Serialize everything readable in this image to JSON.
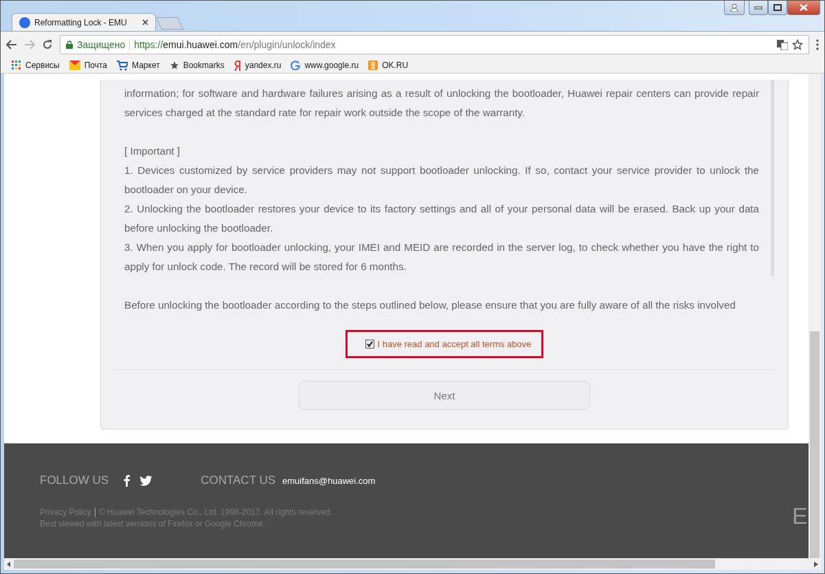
{
  "browser": {
    "tabs": [
      {
        "title": "Reformatting Lock - EMU",
        "selected": true
      }
    ],
    "address": {
      "secure_label": "Защищено",
      "scheme": "https://",
      "host": "emui.huawei.com",
      "path": "/en/plugin/unlock/index"
    },
    "bookmarks": [
      {
        "label": "Сервисы",
        "kind": "apps"
      },
      {
        "label": "Почта",
        "kind": "mail"
      },
      {
        "label": "Маркет",
        "kind": "cart"
      },
      {
        "label": "Bookmarks",
        "kind": "star"
      },
      {
        "label": "yandex.ru",
        "kind": "ya"
      },
      {
        "label": "www.google.ru",
        "kind": "g"
      },
      {
        "label": "OK.RU",
        "kind": "ok"
      }
    ]
  },
  "terms": {
    "paragraphs": [
      "information; for software and hardware failures arising as a result of unlocking the bootloader, Huawei repair centers can provide repair services charged at the standard rate for repair work outside the scope of the warranty.",
      "[ Important ]",
      "1. Devices customized by service providers may not support bootloader unlocking. If so, contact your service provider to unlock the bootloader on your device.",
      "2. Unlocking the bootloader restores your device to its factory settings and all of your personal data will be erased. Back up your data before unlocking the bootloader.",
      "3. When you apply for bootloader unlocking, your IMEI and MEID are recorded in the server log, to check whether you have the right to apply for unlock code. The record will be stored for 6 months.",
      "Before unlocking the bootloader according to the steps outlined below, please ensure that you are fully aware of all the risks involved"
    ],
    "agree": {
      "label": "I have read and accept all terms above",
      "checked": true
    },
    "next_button": "Next"
  },
  "footer": {
    "follow_label": "FOLLOW US",
    "contact_label": "CONTACT US",
    "email": "emuifans@huawei.com",
    "privacy_link": "Privacy Policy",
    "copyright": "© Huawei Technologies Co., Ltd. 1998-2017. All rights reserved.",
    "browser_note": "Best viewed with latest versions of Firefox or Google Chrome.",
    "logo_fragment": "E"
  }
}
